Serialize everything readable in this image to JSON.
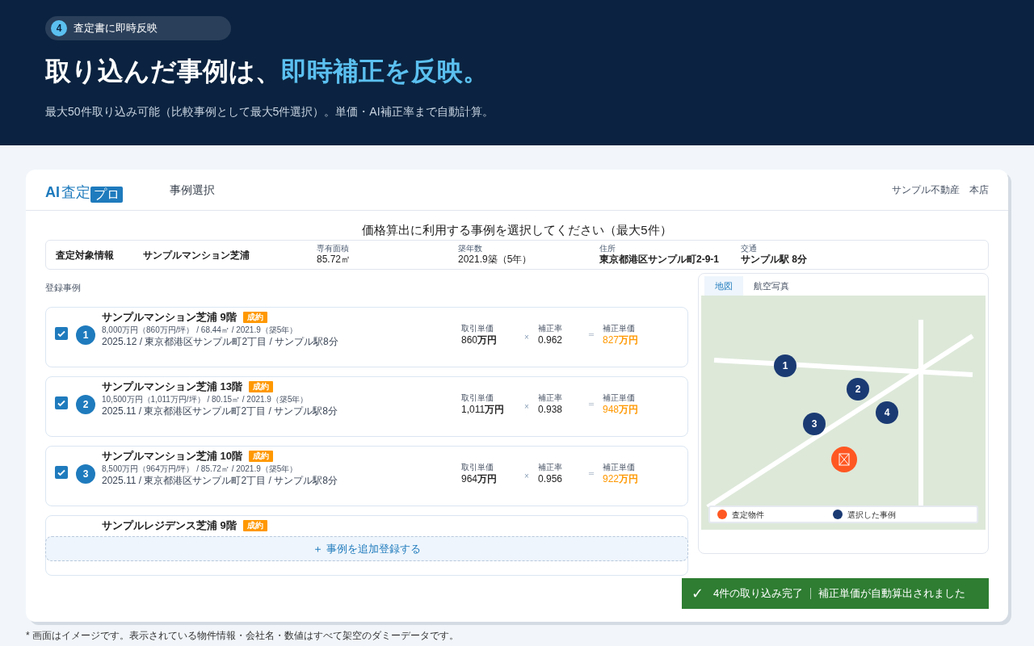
{
  "hero": {
    "step_number": "4",
    "step_label": "査定書に即時反映",
    "title_lead": "取り込んだ事例は、",
    "title_highlight": "即時補正を反映。",
    "subtitle": "最大50件取り込み可能（比較事例として最大5件選択）。単価・AI補正率まで自動計算。"
  },
  "app": {
    "logo_ai": "AI",
    "logo_text": "査定",
    "logo_badge": "プロ",
    "nav_item": "事例選択",
    "company": "サンプル不動産　本店",
    "instruction": "価格算出に利用する事例を選択してください（最大5件）",
    "subject": {
      "heading": "査定対象情報",
      "name": "サンプルマンション芝浦",
      "fields": [
        {
          "label": "専有面積",
          "value": "85.72㎡"
        },
        {
          "label": "築年数",
          "value": "2021.9築（5年）"
        },
        {
          "label": "住所",
          "value": "東京都港区サンプル町2-9-1"
        },
        {
          "label": "交通",
          "value": "サンプル駅 8分"
        }
      ]
    },
    "cases_heading": "登録事例",
    "cases": [
      {
        "kind": "full",
        "checked": true,
        "number": "1",
        "name": "サンプルマンション芝浦 9階",
        "badge": "成約",
        "detail": "8,000万円（860万円/坪） / 68.44㎡ / 2021.9（築5年）",
        "detail2": "2025.12 / 東京都港区サンプル町2丁目 / サンプル駅8分",
        "price_label": "取引単価",
        "price": "860**万円**",
        "times": "×",
        "rate_label": "補正率",
        "rate": "0.962",
        "equals": "＝",
        "corrected_label": "補正単価",
        "corrected": "827**万円**"
      },
      {
        "kind": "full",
        "checked": true,
        "number": "2",
        "name": "サンプルマンション芝浦 13階",
        "badge": "成約",
        "detail": "10,500万円（1,011万円/坪） / 80.15㎡ / 2021.9（築5年）",
        "detail2": "2025.11 / 東京都港区サンプル町2丁目 / サンプル駅8分",
        "price_label": "取引単価",
        "price": "1,011**万円**",
        "times": "×",
        "rate_label": "補正率",
        "rate": "0.938",
        "equals": "＝",
        "corrected_label": "補正単価",
        "corrected": "948**万円**"
      },
      {
        "kind": "full",
        "checked": true,
        "number": "3",
        "name": "サンプルマンション芝浦 10階",
        "badge": "成約",
        "detail": "8,500万円（964万円/坪） / 85.72㎡ / 2021.9（築5年）",
        "detail2": "2025.11 / 東京都港区サンプル町2丁目 / サンプル駅8分",
        "price_label": "取引単価",
        "price": "964**万円**",
        "times": "×",
        "rate_label": "補正率",
        "rate": "0.956",
        "equals": "＝",
        "corrected_label": "補正単価",
        "corrected": "922**万円**"
      },
      {
        "kind": "covered",
        "name": "サンプルレジデンス芝浦 9階",
        "badge": "成約"
      }
    ],
    "add_button": "＋ 事例を追加登録する",
    "map": {
      "tabs": [
        {
          "label": "地図",
          "selected": true
        },
        {
          "label": "航空写真",
          "selected": false
        }
      ],
      "pins": [
        {
          "label": "1"
        },
        {
          "label": "2"
        },
        {
          "label": "3"
        },
        {
          "label": "4"
        }
      ],
      "legend": [
        {
          "label": "査定物件",
          "color": "#ff5722"
        },
        {
          "label": "選択した事例",
          "color": "#1a3a73"
        }
      ]
    },
    "toast": {
      "icon": "✓",
      "message": "4件の取り込み完了",
      "detail": "補正単価が自動算出されました"
    }
  },
  "footnote": "* 画面はイメージです。表示されている物件情報・会社名・数値はすべて架空のダミーデータです。"
}
